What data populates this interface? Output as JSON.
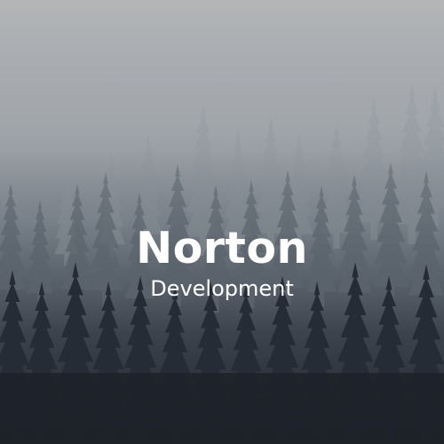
{
  "brand": {
    "name": "Norton",
    "subtitle": "Development"
  },
  "colors": {
    "sky_top": "#a9acaf",
    "fog_mid": "#7f8890",
    "forest_dark": "#1e232b",
    "text": "#ffffff"
  }
}
